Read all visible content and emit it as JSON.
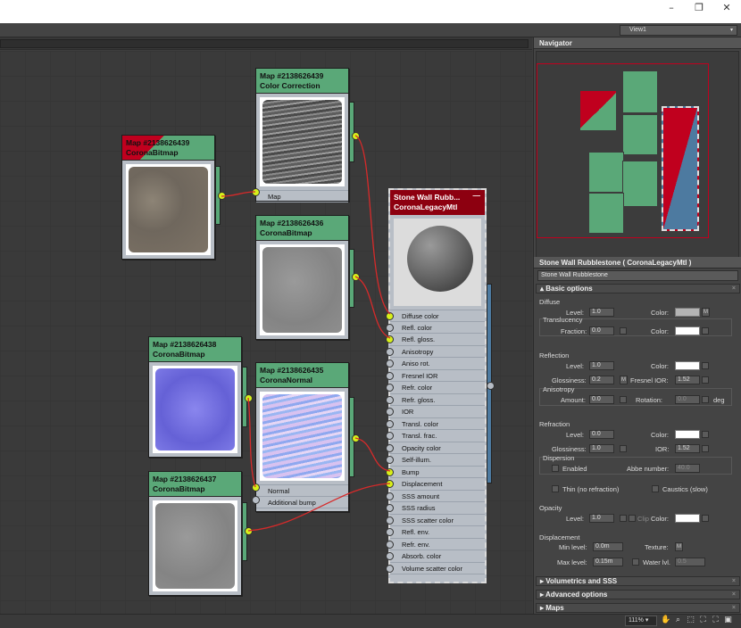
{
  "window": {
    "minimize": "–",
    "maximize": "❐",
    "close": "✕"
  },
  "view_dropdown": {
    "value": "View1",
    "arrow": "▾"
  },
  "nodes": {
    "color_correction": {
      "line1": "Map #2138626439",
      "line2": "Color Correction",
      "slot": "Map"
    },
    "bitmap_sandy": {
      "line1": "Map #2138626439",
      "line2": "CoronaBitmap"
    },
    "bitmap_gray1": {
      "line1": "Map #2138626436",
      "line2": "CoronaBitmap"
    },
    "bitmap_normal": {
      "line1": "Map #2138626438",
      "line2": "CoronaBitmap"
    },
    "corona_normal": {
      "line1": "Map #2138626435",
      "line2": "CoronaNormal",
      "slots": [
        "Normal",
        "Additional bump"
      ]
    },
    "bitmap_gray2": {
      "line1": "Map #2138626437",
      "line2": "CoronaBitmap"
    }
  },
  "material_node": {
    "line1": "Stone Wall Rubb...",
    "line2": "CoronaLegacyMtl",
    "min_icon": "—",
    "slots": [
      "Diffuse color",
      "Refl. color",
      "Refl. gloss.",
      "Anisotropy",
      "Aniso rot.",
      "Fresnel IOR",
      "Refr. color",
      "Refr. gloss.",
      "IOR",
      "Transl. color",
      "Transl. frac.",
      "Opacity color",
      "Self-illum.",
      "Bump",
      "Displacement",
      "SSS amount",
      "SSS radius",
      "SSS scatter color",
      "Refl. env.",
      "Refr. env.",
      "Absorb. color",
      "Volume scatter color"
    ]
  },
  "navigator": {
    "title": "Navigator"
  },
  "material_panel": {
    "title": "Stone Wall Rubblestone  ( CoronaLegacyMtl )",
    "name": "Stone Wall Rubblestone",
    "basic_options": "Basic options",
    "diffuse": {
      "label": "Diffuse",
      "level_label": "Level:",
      "level": "1.0",
      "color_label": "Color:",
      "m": "M",
      "translucency": "Translucency",
      "fraction_label": "Fraction:",
      "fraction": "0.0",
      "color2_label": "Color:"
    },
    "reflection": {
      "label": "Reflection",
      "level_label": "Level:",
      "level": "1.0",
      "color_label": "Color:",
      "gloss_label": "Glossiness:",
      "gloss": "0.2",
      "m": "M",
      "fresnel_label": "Fresnel IOR:",
      "fresnel": "1.52",
      "anisotropy": "Anisotropy",
      "amount_label": "Amount:",
      "amount": "0.0",
      "rotation_label": "Rotation:",
      "rotation": "0.0",
      "deg": "deg"
    },
    "refraction": {
      "label": "Refraction",
      "level_label": "Level:",
      "level": "0.0",
      "color_label": "Color:",
      "gloss_label": "Glossiness:",
      "gloss": "1.0",
      "ior_label": "IOR:",
      "ior": "1.52",
      "dispersion": "Dispersion",
      "enabled": "Enabled",
      "abbe_label": "Abbe number:",
      "abbe": "40.0",
      "thin": "Thin (no refraction)",
      "caustics": "Caustics (slow)"
    },
    "opacity": {
      "label": "Opacity",
      "level_label": "Level:",
      "level": "1.0",
      "clip": "Clip",
      "color_label": "Color:"
    },
    "displacement": {
      "label": "Displacement",
      "min_label": "Min level:",
      "min": "0.0m",
      "texture_label": "Texture:",
      "m": "M",
      "max_label": "Max level:",
      "max": "0.15m",
      "water_label": "Water lvl.",
      "water": "0.5"
    },
    "rollouts": [
      "Volumetrics and SSS",
      "Advanced options",
      "Maps"
    ]
  },
  "status": {
    "zoom": "111%",
    "zoom_arrow": "▾"
  }
}
